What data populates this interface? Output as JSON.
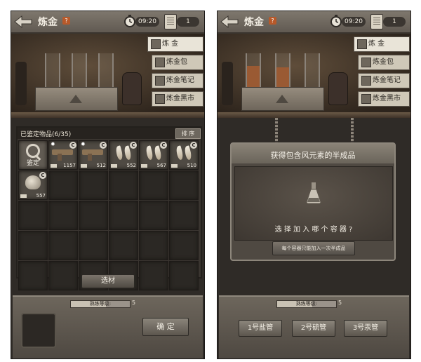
{
  "left": {
    "header": {
      "title": "炼金",
      "help": "?",
      "time": "09:20",
      "count": "1"
    },
    "menu": [
      "炼 金",
      "炼金包",
      "炼金笔记",
      "炼金黑市"
    ],
    "inventory": {
      "title": "已鉴定物品(6/35)",
      "sort": "排 序",
      "search_label": "鉴定",
      "items": [
        {
          "kind": "gun",
          "qty": "1157",
          "badge": "C"
        },
        {
          "kind": "gun",
          "qty": "512",
          "badge": "C"
        },
        {
          "kind": "claw",
          "qty": "552",
          "badge": "C"
        },
        {
          "kind": "claw",
          "qty": "567",
          "badge": "C"
        },
        {
          "kind": "claw",
          "qty": "510",
          "badge": "C"
        },
        {
          "kind": "shell",
          "qty": "557",
          "badge": "C"
        }
      ]
    },
    "select_label": "选材",
    "bottom": {
      "skill_label": "熟练等级:",
      "skill_value": "5",
      "confirm": "确 定"
    }
  },
  "right": {
    "header": {
      "title": "炼金",
      "help": "?",
      "time": "09:20",
      "count": "1"
    },
    "menu": [
      "炼 金",
      "炼金包",
      "炼金笔记",
      "炼金黑市"
    ],
    "dialog": {
      "title": "获得包含风元素的半成品",
      "question": "选 择 加 入 哪 个 容 器 ?",
      "note": "每个容器只能加入一次半成品"
    },
    "bottom": {
      "skill_label": "熟练等级:",
      "skill_value": "5",
      "tubes": [
        "1号盐管",
        "2号硫管",
        "3号汞管"
      ]
    }
  },
  "skill_progress": 0.6,
  "colors": {
    "accent": "#b7592a",
    "panel": "#2f2b27"
  }
}
